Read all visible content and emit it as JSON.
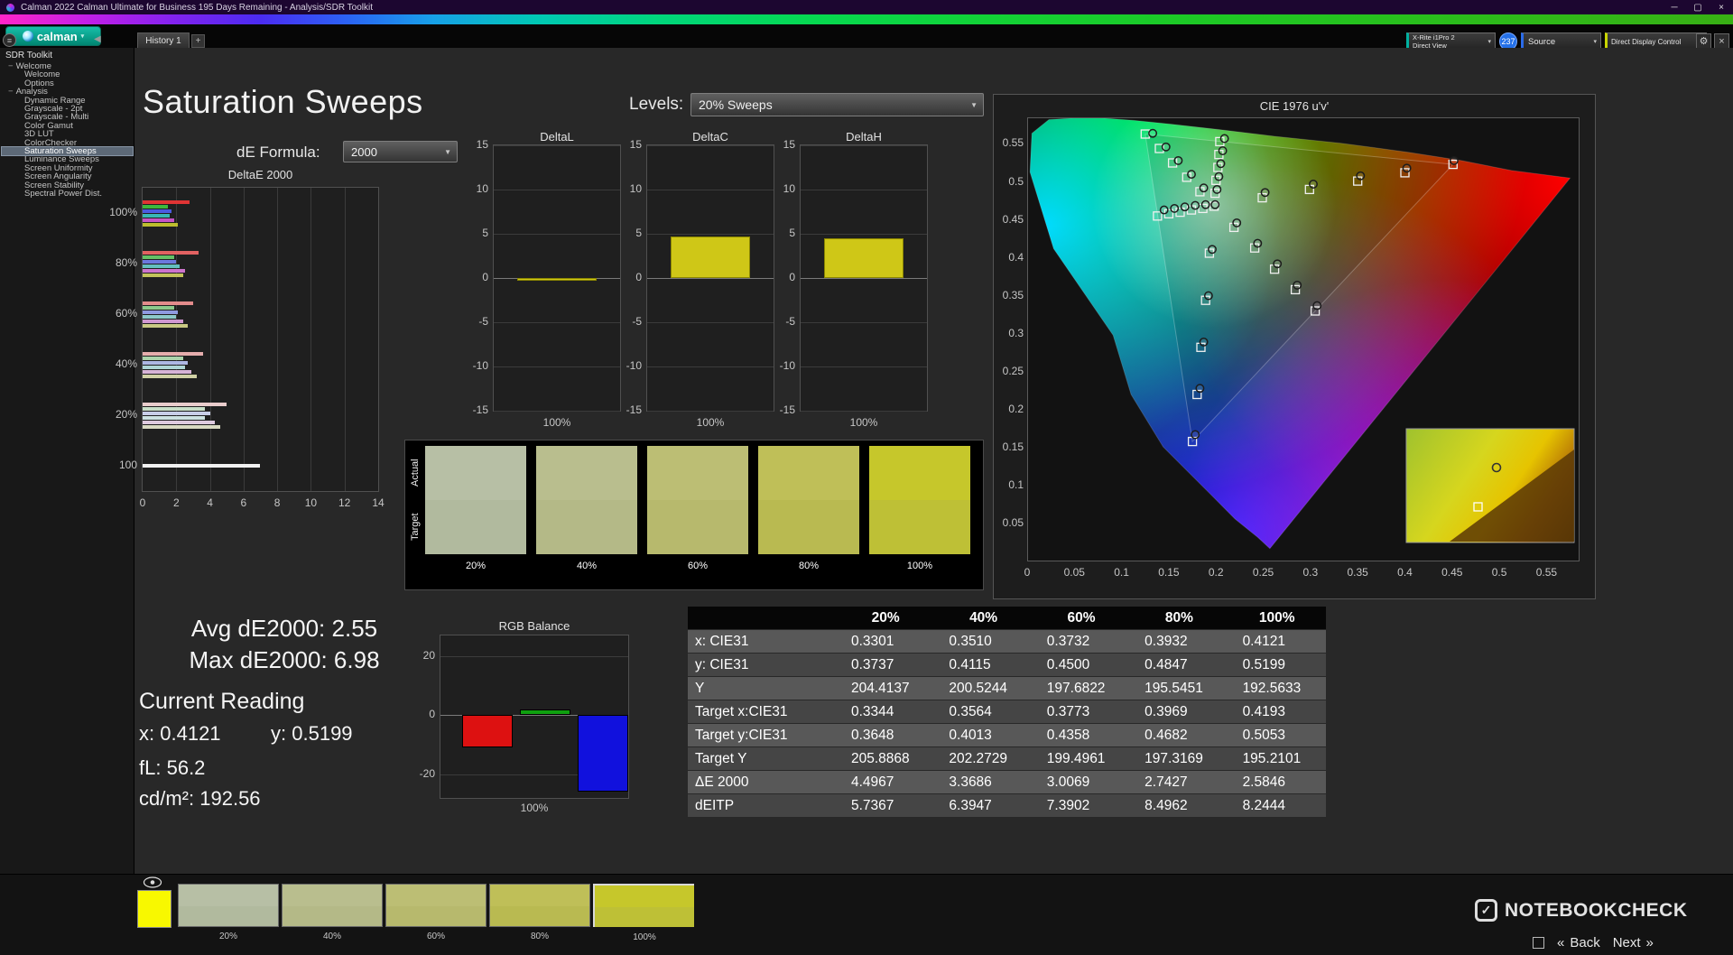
{
  "titlebar": {
    "title": "Calman 2022 Calman Ultimate for Business 195 Days Remaining  - Analysis/SDR Toolkit"
  },
  "icons": {
    "caret": "▾",
    "dropdown": "▼",
    "minimize": "─",
    "maximize": "▢",
    "close": "✕",
    "window_close": "×",
    "collapse_left": "◀",
    "menu": "≡",
    "gear": "⚙",
    "check": "✓"
  },
  "logo": {
    "text": "calman"
  },
  "topbar": {
    "tab": "History 1",
    "tab_add": "+",
    "meter": {
      "line1": "X-Rite i1Pro 2",
      "line2": "Direct View"
    },
    "badge": "237",
    "source": "Source",
    "display_control": "Direct Display Control"
  },
  "sidebar": {
    "title": "SDR Toolkit",
    "items": [
      {
        "label": "Welcome",
        "group": true
      },
      {
        "label": "Welcome"
      },
      {
        "label": "Options"
      },
      {
        "label": "Analysis",
        "group": true
      },
      {
        "label": "Dynamic Range"
      },
      {
        "label": "Grayscale - 2pt"
      },
      {
        "label": "Grayscale - Multi"
      },
      {
        "label": "Color Gamut"
      },
      {
        "label": "3D LUT"
      },
      {
        "label": "ColorChecker"
      },
      {
        "label": "Saturation Sweeps",
        "selected": true
      },
      {
        "label": "Luminance Sweeps"
      },
      {
        "label": "Screen Uniformity"
      },
      {
        "label": "Screen Angularity"
      },
      {
        "label": "Screen Stability"
      },
      {
        "label": "Spectral Power Dist."
      }
    ]
  },
  "page": {
    "title": "Saturation Sweeps"
  },
  "controls": {
    "levels_label": "Levels:",
    "levels_value": "20% Sweeps",
    "formula_label": "dE Formula:",
    "formula_value": "2000"
  },
  "stats": {
    "avg_label": "Avg dE2000:",
    "avg_value": "2.55",
    "max_label": "Max dE2000:",
    "max_value": "6.98"
  },
  "current_reading": {
    "title": "Current Reading",
    "x_label": "x:",
    "x_value": "0.4121",
    "y_label": "y:",
    "y_value": "0.5199",
    "fl_label": "fL:",
    "fl_value": "56.2",
    "cd_label": "cd/m²:",
    "cd_value": "192.56"
  },
  "swatches": {
    "actual_label": "Actual",
    "target_label": "Target",
    "items": [
      {
        "label": "20%",
        "actual": "#b7bfa5",
        "target": "#b1ba9e"
      },
      {
        "label": "40%",
        "actual": "#b9be8e",
        "target": "#b4b987"
      },
      {
        "label": "60%",
        "actual": "#bcbe74",
        "target": "#b7b96d"
      },
      {
        "label": "80%",
        "actual": "#bfbf58",
        "target": "#b9ba51"
      },
      {
        "label": "100%",
        "actual": "#c6c72b",
        "target": "#bec036"
      }
    ]
  },
  "table": {
    "columns": [
      "20%",
      "40%",
      "60%",
      "80%",
      "100%"
    ],
    "rows": [
      {
        "label": "x: CIE31",
        "values": [
          "0.3301",
          "0.3510",
          "0.3732",
          "0.3932",
          "0.4121"
        ]
      },
      {
        "label": "y: CIE31",
        "values": [
          "0.3737",
          "0.4115",
          "0.4500",
          "0.4847",
          "0.5199"
        ]
      },
      {
        "label": "Y",
        "values": [
          "204.4137",
          "200.5244",
          "197.6822",
          "195.5451",
          "192.5633"
        ]
      },
      {
        "label": "Target x:CIE31",
        "values": [
          "0.3344",
          "0.3564",
          "0.3773",
          "0.3969",
          "0.4193"
        ]
      },
      {
        "label": "Target y:CIE31",
        "values": [
          "0.3648",
          "0.4013",
          "0.4358",
          "0.4682",
          "0.5053"
        ]
      },
      {
        "label": "Target Y",
        "values": [
          "205.8868",
          "202.2729",
          "199.4961",
          "197.3169",
          "195.2101"
        ]
      },
      {
        "label": "ΔE 2000",
        "values": [
          "4.4967",
          "3.3686",
          "3.0069",
          "2.7427",
          "2.5846"
        ]
      },
      {
        "label": "dEITP",
        "values": [
          "5.7367",
          "6.3947",
          "7.3902",
          "8.4962",
          "8.2444"
        ]
      }
    ]
  },
  "nav": {
    "back": "Back",
    "next": "Next",
    "back_arrow": "«",
    "next_arrow": "»"
  },
  "watermark": {
    "text": "NOTEBOOKCHECK"
  },
  "chart_data": [
    {
      "id": "deltaE2000",
      "type": "bar",
      "orientation": "horizontal",
      "title": "DeltaE 2000",
      "xlim": [
        0,
        14
      ],
      "x_ticks": [
        0,
        2,
        4,
        6,
        8,
        10,
        12,
        14
      ],
      "groups": [
        {
          "label": "100%",
          "bars": [
            {
              "color": "#e03434",
              "value": 2.8
            },
            {
              "color": "#3db83d",
              "value": 1.5
            },
            {
              "color": "#4b5ae0",
              "value": 1.7
            },
            {
              "color": "#38b6b6",
              "value": 1.6
            },
            {
              "color": "#c653c6",
              "value": 1.9
            },
            {
              "color": "#bdbd2e",
              "value": 2.1
            }
          ]
        },
        {
          "label": "80%",
          "bars": [
            {
              "color": "#e16161",
              "value": 3.3
            },
            {
              "color": "#65c065",
              "value": 1.9
            },
            {
              "color": "#6b78dd",
              "value": 2.0
            },
            {
              "color": "#63bfbf",
              "value": 2.2
            },
            {
              "color": "#cc74cc",
              "value": 2.5
            },
            {
              "color": "#c3c35a",
              "value": 2.4
            }
          ]
        },
        {
          "label": "60%",
          "bars": [
            {
              "color": "#e28b8b",
              "value": 3.0
            },
            {
              "color": "#8cc98c",
              "value": 1.9
            },
            {
              "color": "#8f9ae0",
              "value": 2.1
            },
            {
              "color": "#8dc9c9",
              "value": 2.0
            },
            {
              "color": "#d098d0",
              "value": 2.4
            },
            {
              "color": "#c9c983",
              "value": 2.7
            }
          ]
        },
        {
          "label": "40%",
          "bars": [
            {
              "color": "#e5adad",
              "value": 3.6
            },
            {
              "color": "#abd3ab",
              "value": 2.4
            },
            {
              "color": "#adb7e3",
              "value": 2.7
            },
            {
              "color": "#aed5d5",
              "value": 2.5
            },
            {
              "color": "#d7b4d7",
              "value": 2.9
            },
            {
              "color": "#d0d0a5",
              "value": 3.2
            }
          ]
        },
        {
          "label": "20%",
          "bars": [
            {
              "color": "#e9cccc",
              "value": 5.0
            },
            {
              "color": "#c8dec8",
              "value": 3.7
            },
            {
              "color": "#c8cee8",
              "value": 4.0
            },
            {
              "color": "#cde2e2",
              "value": 3.7
            },
            {
              "color": "#decade",
              "value": 4.3
            },
            {
              "color": "#d9d9c2",
              "value": 4.6
            }
          ]
        },
        {
          "label": "100",
          "bars": [
            {
              "color": "#f2f2f2",
              "value": 6.98
            }
          ]
        }
      ]
    },
    {
      "id": "deltaL",
      "type": "bar",
      "title": "DeltaL",
      "ylim": [
        -15,
        15
      ],
      "y_ticks": [
        15,
        10,
        5,
        0,
        -5,
        -10,
        -15
      ],
      "xlabel": "100%",
      "value": -0.3,
      "color": "#cfc717"
    },
    {
      "id": "deltaC",
      "type": "bar",
      "title": "DeltaC",
      "ylim": [
        -15,
        15
      ],
      "y_ticks": [
        15,
        10,
        5,
        0,
        -5,
        -10,
        -15
      ],
      "xlabel": "100%",
      "value": 4.7,
      "color": "#cfc717"
    },
    {
      "id": "deltaH",
      "type": "bar",
      "title": "DeltaH",
      "ylim": [
        -15,
        15
      ],
      "y_ticks": [
        15,
        10,
        5,
        0,
        -5,
        -10,
        -15
      ],
      "xlabel": "100%",
      "value": 4.5,
      "color": "#cfc717"
    },
    {
      "id": "cie1976",
      "type": "scatter",
      "title": "CIE 1976 u'v'",
      "xlim": [
        0,
        0.585
      ],
      "ylim": [
        0,
        0.585
      ],
      "x_ticks": [
        "0",
        "0.05",
        "0.1",
        "0.15",
        "0.2",
        "0.25",
        "0.3",
        "0.35",
        "0.4",
        "0.45",
        "0.5",
        "0.55"
      ],
      "y_ticks": [
        "0.55",
        "0.5",
        "0.45",
        "0.4",
        "0.35",
        "0.3",
        "0.25",
        "0.2",
        "0.15",
        "0.1",
        "0.05"
      ],
      "targets": [
        [
          0.249,
          0.479
        ],
        [
          0.299,
          0.49
        ],
        [
          0.35,
          0.501
        ],
        [
          0.4,
          0.512
        ],
        [
          0.451,
          0.523
        ],
        [
          0.183,
          0.487
        ],
        [
          0.169,
          0.506
        ],
        [
          0.154,
          0.525
        ],
        [
          0.14,
          0.544
        ],
        [
          0.125,
          0.563
        ],
        [
          0.193,
          0.406
        ],
        [
          0.189,
          0.344
        ],
        [
          0.184,
          0.282
        ],
        [
          0.18,
          0.22
        ],
        [
          0.175,
          0.158
        ],
        [
          0.186,
          0.465
        ],
        [
          0.174,
          0.463
        ],
        [
          0.162,
          0.46
        ],
        [
          0.15,
          0.458
        ],
        [
          0.138,
          0.455
        ],
        [
          0.219,
          0.44
        ],
        [
          0.241,
          0.413
        ],
        [
          0.262,
          0.385
        ],
        [
          0.284,
          0.358
        ],
        [
          0.305,
          0.33
        ],
        [
          0.199,
          0.485
        ],
        [
          0.2,
          0.502
        ],
        [
          0.202,
          0.519
        ],
        [
          0.203,
          0.536
        ],
        [
          0.204,
          0.553
        ],
        [
          0.198,
          0.468
        ]
      ],
      "measured": [
        [
          0.252,
          0.486
        ],
        [
          0.303,
          0.497
        ],
        [
          0.353,
          0.508
        ],
        [
          0.402,
          0.518
        ],
        [
          0.452,
          0.528
        ],
        [
          0.187,
          0.492
        ],
        [
          0.174,
          0.51
        ],
        [
          0.16,
          0.528
        ],
        [
          0.147,
          0.546
        ],
        [
          0.133,
          0.564
        ],
        [
          0.196,
          0.411
        ],
        [
          0.192,
          0.35
        ],
        [
          0.187,
          0.289
        ],
        [
          0.183,
          0.228
        ],
        [
          0.178,
          0.167
        ],
        [
          0.189,
          0.47
        ],
        [
          0.178,
          0.469
        ],
        [
          0.167,
          0.467
        ],
        [
          0.156,
          0.465
        ],
        [
          0.145,
          0.463
        ],
        [
          0.222,
          0.446
        ],
        [
          0.244,
          0.419
        ],
        [
          0.265,
          0.392
        ],
        [
          0.286,
          0.364
        ],
        [
          0.307,
          0.337
        ],
        [
          0.201,
          0.49
        ],
        [
          0.203,
          0.507
        ],
        [
          0.205,
          0.524
        ],
        [
          0.207,
          0.541
        ],
        [
          0.209,
          0.557
        ],
        [
          0.199,
          0.47
        ]
      ]
    },
    {
      "id": "rgb_balance",
      "type": "bar",
      "title": "RGB Balance",
      "categories": [
        "Red",
        "Green",
        "Blue"
      ],
      "values": [
        -11,
        2,
        -26
      ],
      "colors": [
        "#dd1111",
        "#0fa00f",
        "#1111dd"
      ],
      "y_ticks": [
        20,
        0,
        -20
      ],
      "ylim": [
        -28,
        27
      ],
      "xlabel": "100%"
    }
  ]
}
